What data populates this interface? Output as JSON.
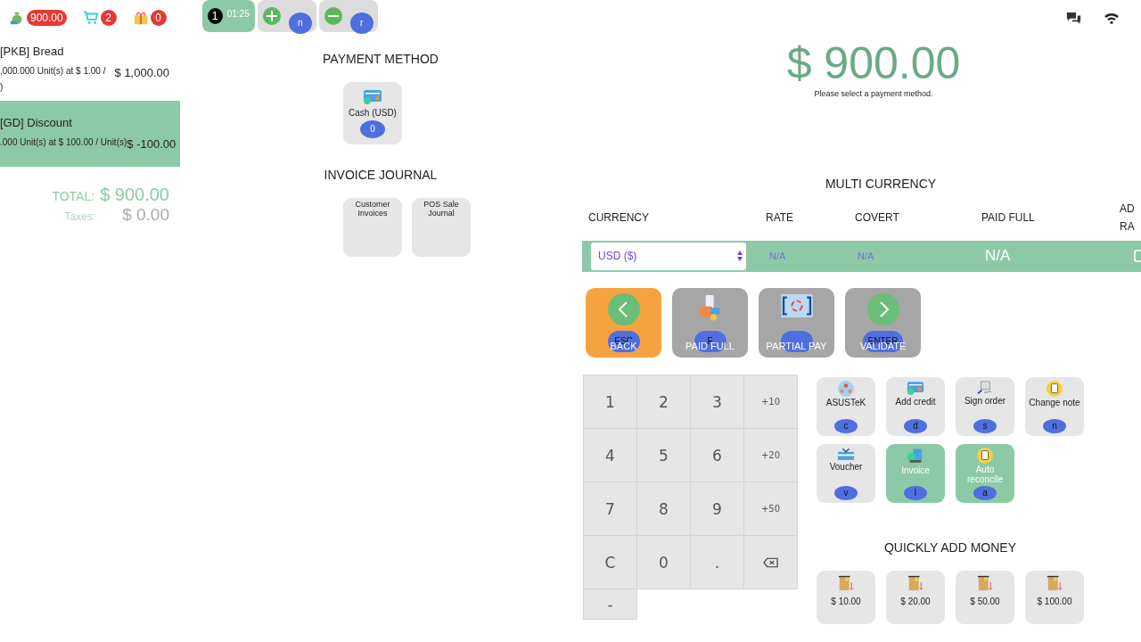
{
  "top_bar": {
    "balance": "900.00",
    "cart_count": "2",
    "gift_count": "0",
    "orders": [
      {
        "kind": "order",
        "number": "1",
        "time": "01:25",
        "selected": true
      },
      {
        "kind": "add",
        "key": "n",
        "selected": false
      },
      {
        "kind": "remove",
        "key": "r",
        "selected": false
      }
    ]
  },
  "order_lines": [
    {
      "name": "[PKB] Bread",
      "detail_lines": [
        ",000.000 Unit(s) at $ 1.00 /",
        ")"
      ],
      "price": "$ 1,000.00",
      "selected": false
    },
    {
      "name": "[GD] Discount",
      "detail_lines": [
        ".000 Unit(s) at $ 100.00 / Unit(s)"
      ],
      "price": "$ -100.00",
      "selected": true
    }
  ],
  "totals": {
    "total_label": "TOTAL:",
    "total": "$ 900.00",
    "taxes_label": "Taxes:",
    "taxes": "$ 0.00"
  },
  "payment_methods": {
    "title": "PAYMENT METHOD",
    "items": [
      {
        "label": "Cash (USD)",
        "count": "0"
      }
    ]
  },
  "invoice_journal": {
    "title": "INVOICE JOURNAL",
    "items": [
      "Customer Invoices",
      "POS Sale Journal"
    ]
  },
  "amount_due": {
    "amount": "$ 900.00",
    "message": "Please select a payment method."
  },
  "multi_currency": {
    "title": "MULTI CURRENCY",
    "columns": [
      "CURRENCY",
      "RATE",
      "COVERT",
      "PAID FULL",
      "AD RA"
    ],
    "row": {
      "currency": "USD ($)",
      "rate": "N/A",
      "covert": "N/A",
      "paid_full": "N/A"
    }
  },
  "actions": [
    {
      "kind": "back",
      "key": "ESC",
      "label": "BACK"
    },
    {
      "kind": "paid_full",
      "key": "F",
      "label": "PAID FULL"
    },
    {
      "kind": "partial",
      "label": "PARTIAL PAY"
    },
    {
      "kind": "validate",
      "key": "ENTER",
      "label": "VALIDATE"
    }
  ],
  "numpad": [
    {
      "kind": "digit",
      "label": "1"
    },
    {
      "kind": "digit",
      "label": "2"
    },
    {
      "kind": "digit",
      "label": "3"
    },
    {
      "kind": "small",
      "label": "+10"
    },
    {
      "kind": "digit",
      "label": "4"
    },
    {
      "kind": "digit",
      "label": "5"
    },
    {
      "kind": "digit",
      "label": "6"
    },
    {
      "kind": "small",
      "label": "+20"
    },
    {
      "kind": "digit",
      "label": "7"
    },
    {
      "kind": "digit",
      "label": "8"
    },
    {
      "kind": "digit",
      "label": "9"
    },
    {
      "kind": "small",
      "label": "+50"
    },
    {
      "kind": "digit",
      "label": "C"
    },
    {
      "kind": "digit",
      "label": "0"
    },
    {
      "kind": "digit",
      "label": "."
    },
    {
      "kind": "backspace"
    },
    {
      "kind": "digit",
      "label": "-"
    }
  ],
  "extras": [
    {
      "kind": "people",
      "label": "ASUSTeK",
      "key": "c",
      "active": false
    },
    {
      "kind": "card",
      "label": "Add credit",
      "key": "d",
      "active": false
    },
    {
      "kind": "sign",
      "label": "Sign order",
      "key": "s",
      "active": false
    },
    {
      "kind": "note",
      "label": "Change note",
      "key": "n",
      "active": false
    },
    {
      "kind": "voucher",
      "label": "Voucher",
      "key": "v",
      "active": false
    },
    {
      "kind": "invoice",
      "label": "Invoice",
      "key": "I",
      "active": true
    },
    {
      "kind": "note",
      "label": "Auto reconcile",
      "key": "a",
      "active": true
    }
  ],
  "quick_add": {
    "title": "QUICKLY ADD MONEY",
    "amounts": [
      "$ 10.00",
      "$ 20.00",
      "$ 50.00",
      "$ 100.00"
    ]
  }
}
